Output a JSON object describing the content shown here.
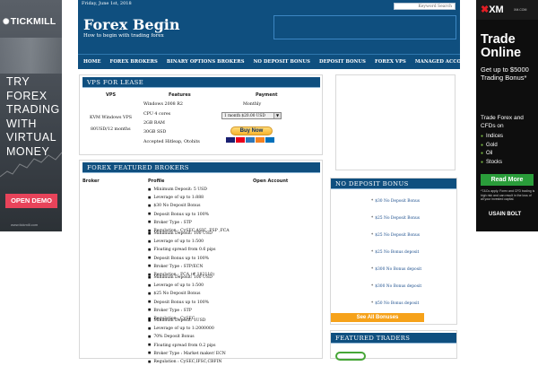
{
  "ads": {
    "tickmill": {
      "logo": "TICKMILL",
      "headline_lines": [
        "TRY",
        "FOREX",
        "TRADING",
        "WITH",
        "VIRTUAL",
        "MONEY"
      ],
      "button": "OPEN DEMO",
      "small_url": "www.tickmill.com"
    },
    "xm": {
      "logo": "XM",
      "url": "XM.COM",
      "headline": "Trade Online",
      "bonus": "Get up to $5000 Trading Bonus*",
      "sub": "Trade Forex and CFDs on",
      "items": [
        "Indices",
        "Gold",
        "Oil",
        "Stocks"
      ],
      "button": "Read More",
      "disclaimer": "*T&Cs apply. Forex and CFD trading is high risk and can result in the loss of all your invested capital.",
      "sponsor": "USAIN BOLT"
    }
  },
  "header": {
    "date": "Friday, June 1st, 2018",
    "search_placeholder": "Keyword Search",
    "title": "Forex Begin",
    "tagline": "How to begin with trading forex"
  },
  "nav": [
    "HOME",
    "FOREX BROKERS",
    "BINARY OPTIONS BROKERS",
    "NO DEPOSIT BONUS",
    "DEPOSIT BONUS",
    "FOREX VPS",
    "MANAGED ACCOUNT"
  ],
  "vps": {
    "title": "VPS FOR LEASE",
    "headers": [
      "VPS",
      "Features",
      "Payment"
    ],
    "name": "KVM Windows VPS",
    "price": "80USD/12 months",
    "features": [
      "Windows 2008 R2",
      "CPU 4 cores",
      "2GB RAM",
      "30GB SSD",
      "Accepted Hitleap, Otohits"
    ],
    "payment_period": "Monthly",
    "select_value": "1 month $20.00 USD",
    "buy_button": "Buy Now"
  },
  "brokers": {
    "title": "FOREX FEATURED BROKERS",
    "headers": [
      "Broker",
      "Profile",
      "Open Account"
    ],
    "profiles": [
      [
        "Minimum Deposit: 5 USD",
        "Leverage of up to 1:888",
        "$30 No Deposit Bonus",
        "Deposit Bonus up to 100%",
        "Broker Type : STP",
        "Regulation : CySEC,ASIC ,FSP ,FCA"
      ],
      [
        "Minimum Deposit: 100 USD",
        "Leverage of up to 1:500",
        "Floating spread from 0.6 pips",
        "Deposit Bonus up to 100%",
        "Broker Type : STP/ECN",
        "Regulation : FCA (# 182110)"
      ],
      [
        "Minimum Deposit: 100 USD",
        "Leverage of up to 1:500",
        "$25 No Deposit Bonus",
        "Deposit Bonus up to 100%",
        "Broker Type : STP",
        "Regulation : CySEC"
      ],
      [
        "Minimum Deposit: 1USD",
        "Leverage of up to 1:2000000",
        "70% Deposit Bonus",
        "Floating spread from 0.2 pips",
        "Broker Type : Market maker/ ECN",
        "Regulation : CySEC,IFSC,CBFIN"
      ]
    ]
  },
  "no_deposit": {
    "title": "NO DEPOSIT BONUS",
    "items": [
      "$30 No Deposit Bonus",
      "$25 No Deposit Bonus",
      "$25 No Deposit Bonus",
      "$25 No Bonus deposit",
      "$300 No Bonus deposit",
      "$300 No Bonus deposit",
      "$50 No Bonus deposit"
    ],
    "see_all": "See All Bonuses"
  },
  "featured_traders": {
    "title": "FEATURED TRADERS"
  },
  "colors": {
    "navy": "#0f4f7f",
    "orange": "#f6a21a",
    "xm_red": "#e31e24",
    "tickmill_pink": "#e8435a"
  }
}
